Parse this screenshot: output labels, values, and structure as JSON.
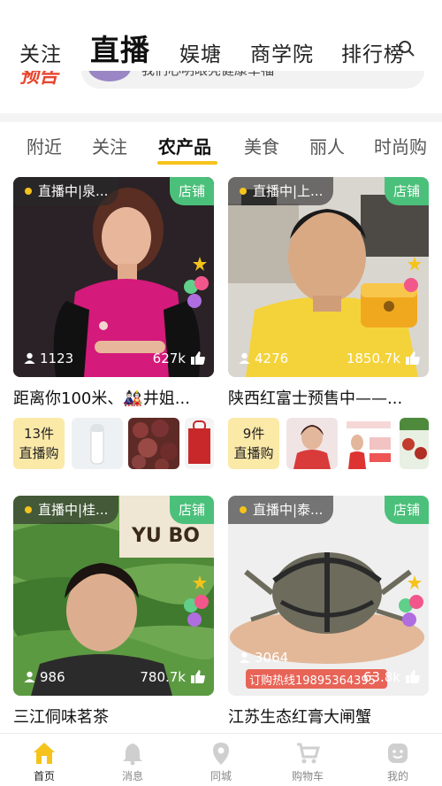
{
  "top_nav": {
    "tabs": [
      "关注",
      "直播",
      "娱塘",
      "商学院",
      "排行榜"
    ],
    "active": "直播"
  },
  "banner": {
    "logo_text": "预告",
    "text": "我们心明眼亮健康幸福"
  },
  "categories": {
    "items": [
      "附近",
      "关注",
      "农产品",
      "美食",
      "丽人",
      "时尚购"
    ],
    "active": "农产品"
  },
  "cards": [
    {
      "live_label": "直播中|泉...",
      "shop_label": "店铺",
      "viewers": "1123",
      "likes": "627k",
      "title": "距离你100米、🎎井姐...",
      "products_count": "13件",
      "products_label": "直播购"
    },
    {
      "live_label": "直播中|上...",
      "shop_label": "店铺",
      "viewers": "4276",
      "likes": "1850.7k",
      "title": "陕西红富士预售中——...",
      "products_count": "9件",
      "products_label": "直播购"
    },
    {
      "live_label": "直播中|桂...",
      "shop_label": "店铺",
      "viewers": "986",
      "likes": "780.7k",
      "title": "三江侗味茗茶",
      "cover_text": "YU BO LIVE"
    },
    {
      "live_label": "直播中|泰...",
      "shop_label": "店铺",
      "viewers": "3064",
      "likes": "63.8k",
      "title": "江苏生态红膏大闸蟹",
      "cover_text": "订购热线19895364395"
    }
  ],
  "bottom_bar": {
    "items": [
      "首页",
      "消息",
      "同城",
      "购物车",
      "我的"
    ],
    "active": "首页"
  },
  "colors": {
    "accent": "#f5c31b",
    "shop_badge": "#4bc07a",
    "count_bg": "#fbe9a8"
  }
}
